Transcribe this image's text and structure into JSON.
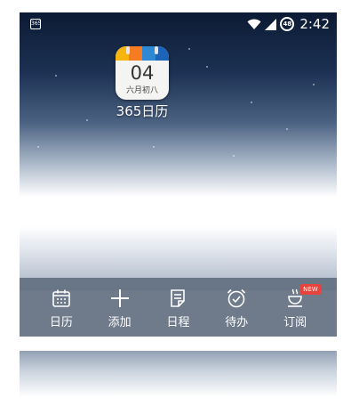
{
  "status_bar": {
    "notification_text": "365",
    "battery_level": "48",
    "time": "2:42"
  },
  "app": {
    "icon_day": "04",
    "icon_lunar": "六月初八",
    "label": "365日历",
    "band_colors": [
      "#f6b40f",
      "#f57c20",
      "#2e88d3",
      "#1b64b8"
    ]
  },
  "toolbar": {
    "items": [
      {
        "label": "日历",
        "icon": "calendar-icon"
      },
      {
        "label": "添加",
        "icon": "plus-icon"
      },
      {
        "label": "日程",
        "icon": "schedule-icon"
      },
      {
        "label": "待办",
        "icon": "alarm-check-icon"
      },
      {
        "label": "订阅",
        "icon": "cup-icon",
        "badge": "NEW"
      }
    ],
    "badge_color": "#e8423c"
  }
}
